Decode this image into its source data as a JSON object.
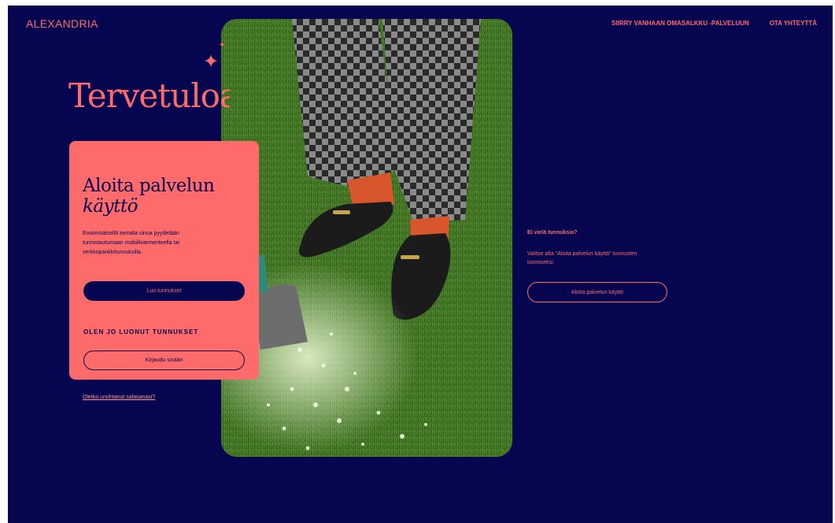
{
  "brand": {
    "logo": "ALEXANDRIA"
  },
  "nav": {
    "links": [
      "SIIRRY VANHAAN OMASALKKU -PALVELUUN",
      "OTA YHTEYTTÄ"
    ]
  },
  "hero": {
    "title": "Tervetuloa"
  },
  "login_card": {
    "title_line1": "Aloita palvelun",
    "title_line2": "käyttö",
    "description": "Ensimmäisellä kerralla sinua pyydetään tunnistautumaan mobiilivarmenteella tai verkkopankkitunnuksilla.",
    "create_button": "Luo tunnukset",
    "existing_label": "OLEN JO LUONUT TUNNUKSET",
    "login_button": "Kirjaudu sisään"
  },
  "forgot_link": "Oletko unohtanut salasanasi?",
  "side": {
    "heading": "Ei vielä tunnuksia?",
    "text": "Valitse alta \"Aloita palvelun käyttö\" tunnusten luomiseksi.",
    "button": "Aloita palvelun käyttö"
  },
  "icons": {
    "sparkle": "sparkle-icon"
  },
  "colors": {
    "background": "#050550",
    "accent": "#ff6b6b",
    "card": "#ff6b6b"
  }
}
